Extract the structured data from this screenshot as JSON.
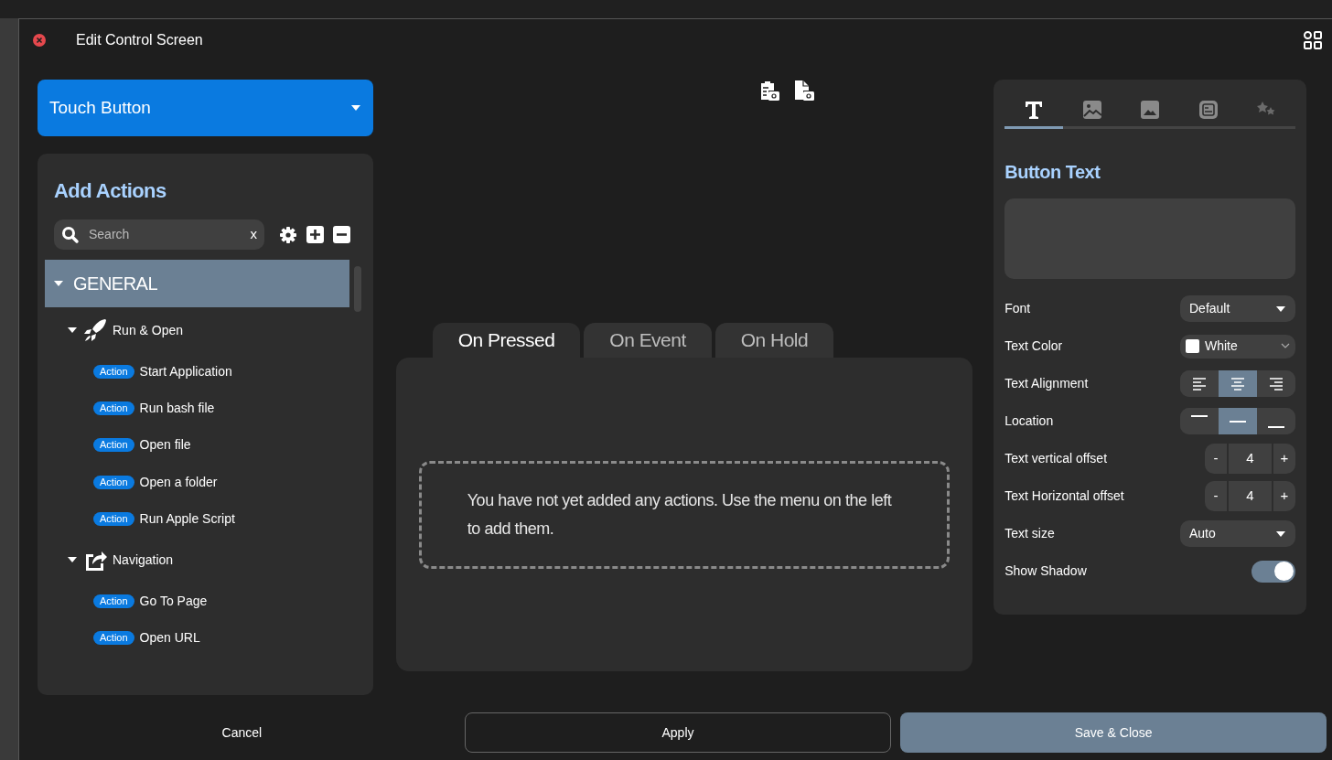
{
  "window": {
    "title": "Edit Control Screen"
  },
  "control_type": {
    "value": "Touch Button"
  },
  "actions_panel": {
    "title": "Add Actions",
    "search": {
      "placeholder": "Search",
      "clear": "x"
    },
    "categories": [
      {
        "label": "GENERAL",
        "expanded": true,
        "selected": true,
        "children": [
          {
            "label": "Run & Open",
            "expanded": true,
            "children": [
              {
                "badge": "Action",
                "label": "Start Application"
              },
              {
                "badge": "Action",
                "label": "Run bash file"
              },
              {
                "badge": "Action",
                "label": "Open file"
              },
              {
                "badge": "Action",
                "label": "Open a folder"
              },
              {
                "badge": "Action",
                "label": "Run Apple Script"
              }
            ]
          },
          {
            "label": "Navigation",
            "expanded": true,
            "children": [
              {
                "badge": "Action",
                "label": "Go To Page"
              },
              {
                "badge": "Action",
                "label": "Open URL"
              }
            ]
          }
        ]
      }
    ]
  },
  "event_tabs": [
    {
      "label": "On Pressed",
      "selected": true
    },
    {
      "label": "On Event",
      "selected": false
    },
    {
      "label": "On Hold",
      "selected": false
    }
  ],
  "empty_message": "You have not yet added any actions. Use the menu on the left to add them.",
  "style_tabs": [
    {
      "selected": true
    },
    {
      "selected": false
    },
    {
      "selected": false
    },
    {
      "selected": false
    },
    {
      "selected": false
    }
  ],
  "section_title": "Button Text",
  "properties": [
    {
      "kind": "dropdown",
      "label": "Font",
      "value": "Default"
    },
    {
      "kind": "color",
      "label": "Text Color",
      "value": "White",
      "color": "#ffffff"
    },
    {
      "kind": "alignment",
      "label": "Text Alignment",
      "options": [
        {
          "selected": false
        },
        {
          "selected": true
        },
        {
          "selected": false
        }
      ]
    },
    {
      "kind": "location",
      "label": "Location",
      "options": [
        {
          "selected": false
        },
        {
          "selected": true
        },
        {
          "selected": false
        }
      ]
    },
    {
      "kind": "stepper",
      "label": "Text vertical offset",
      "value": "4",
      "minus": "-",
      "plus": "+"
    },
    {
      "kind": "stepper",
      "label": "Text Horizontal offset",
      "value": "4",
      "minus": "-",
      "plus": "+"
    },
    {
      "kind": "dropdown",
      "label": "Text size",
      "value": "Auto"
    },
    {
      "kind": "toggle",
      "label": "Show Shadow",
      "on": true
    }
  ],
  "footer_buttons": [
    {
      "kind": "text",
      "label": "Cancel"
    },
    {
      "kind": "outline",
      "label": "Apply"
    },
    {
      "kind": "primary",
      "label": "Save & Close"
    }
  ]
}
